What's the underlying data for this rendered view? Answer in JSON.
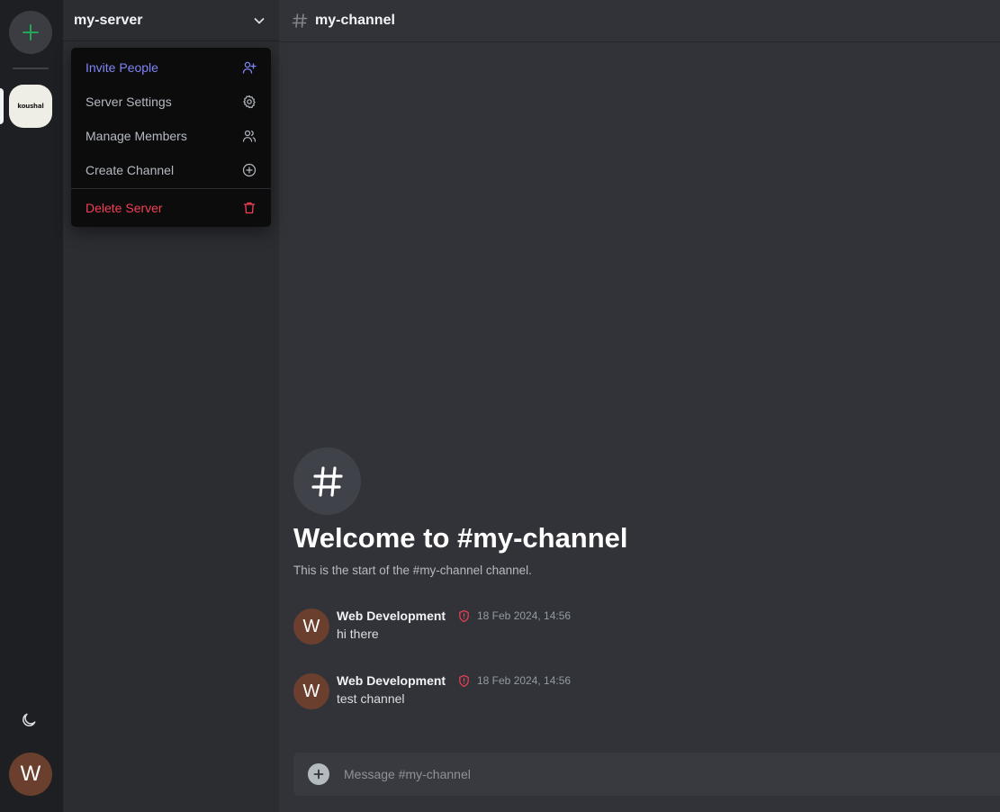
{
  "rail": {
    "add_icon": "plus-icon",
    "server_logo_text": "koushal",
    "theme_icon": "moon-icon",
    "user_avatar_letter": "W"
  },
  "sidebar": {
    "server_name": "my-server",
    "dropdown_icon": "chevron-down-icon"
  },
  "dropdown": {
    "items": [
      {
        "label": "Invite People",
        "icon": "user-plus-icon"
      },
      {
        "label": "Server Settings",
        "icon": "gear-icon"
      },
      {
        "label": "Manage Members",
        "icon": "users-icon"
      },
      {
        "label": "Create Channel",
        "icon": "plus-circle-icon"
      }
    ],
    "danger_item": {
      "label": "Delete Server",
      "icon": "trash-icon"
    }
  },
  "chat": {
    "channel_name": "my-channel",
    "welcome_title": "Welcome to #my-channel",
    "welcome_subtitle": "This is the start of the #my-channel channel.",
    "messages": [
      {
        "avatar_letter": "W",
        "author": "Web Development",
        "badge_icon": "shield-alert-icon",
        "timestamp": "18 Feb 2024, 14:56",
        "text": "hi there"
      },
      {
        "avatar_letter": "W",
        "author": "Web Development",
        "badge_icon": "shield-alert-icon",
        "timestamp": "18 Feb 2024, 14:56",
        "text": "test channel"
      }
    ],
    "composer_placeholder": "Message #my-channel"
  },
  "colors": {
    "accent_green": "#23a55a",
    "invite_purple": "#7f86f5",
    "danger_red": "#f23f56"
  }
}
